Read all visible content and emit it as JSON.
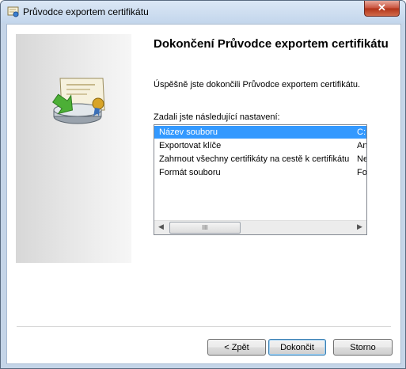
{
  "window": {
    "title": "Průvodce exportem certifikátu",
    "close_glyph": "✕"
  },
  "wizard": {
    "heading": "Dokončení Průvodce exportem certifikátu",
    "success_message": "Úspěšně jste dokončili Průvodce exportem certifikátu.",
    "settings_label": "Zadali jste následující nastavení:",
    "settings": [
      {
        "name": "Název souboru",
        "value": "C:",
        "selected": true
      },
      {
        "name": "Exportovat klíče",
        "value": "An",
        "selected": false
      },
      {
        "name": "Zahrnout všechny certifikáty na cestě k certifikátu",
        "value": "Ne",
        "selected": false
      },
      {
        "name": "Formát souboru",
        "value": "Fo",
        "selected": false
      }
    ],
    "scrollbar": {
      "left_arrow": "◀",
      "right_arrow": "▶",
      "thumb_grip": "III"
    }
  },
  "buttons": {
    "back": "< Zpět",
    "finish": "Dokončit",
    "cancel": "Storno"
  },
  "colors": {
    "selection": "#3399ff",
    "accent_frame": "#c5d5e8"
  }
}
